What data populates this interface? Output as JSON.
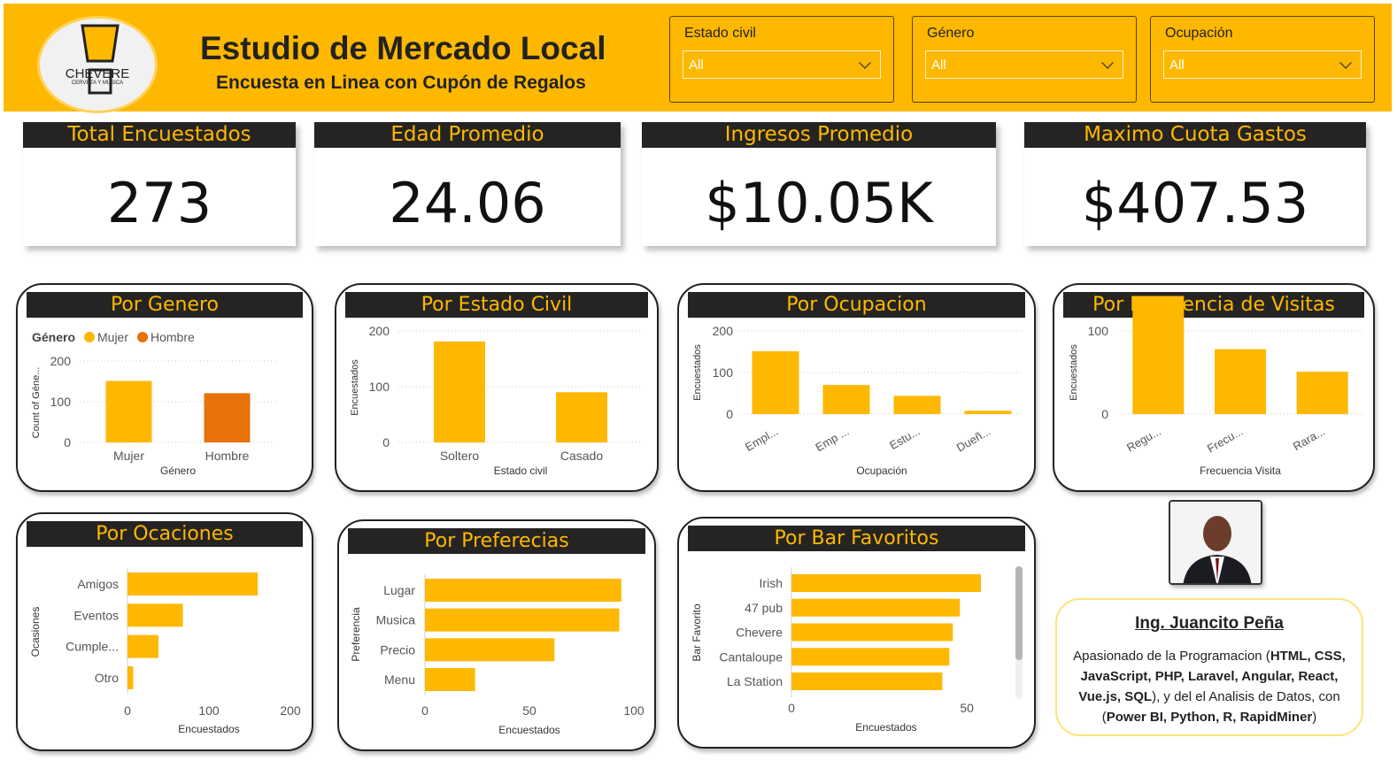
{
  "header": {
    "title": "Estudio de Mercado Local",
    "subtitle": "Encuesta en Linea con Cupón de Regalos",
    "logo_brand": "CHEVERE",
    "logo_tag": "CERVEZA Y MUSICA"
  },
  "slicers": [
    {
      "label": "Estado civil",
      "value": "All"
    },
    {
      "label": "Género",
      "value": "All"
    },
    {
      "label": "Ocupación",
      "value": "All"
    }
  ],
  "kpis": [
    {
      "label": "Total Encuestados",
      "value": "273"
    },
    {
      "label": "Edad Promedio",
      "value": "24.06"
    },
    {
      "label": "Ingresos Promedio",
      "value": "$10.05K"
    },
    {
      "label": "Maximo Cuota Gastos",
      "value": "$407.53"
    }
  ],
  "colors": {
    "accent": "#FFB800",
    "secondary": "#E87208",
    "header_bg": "#252423"
  },
  "chart_data": [
    {
      "id": "genero",
      "type": "bar",
      "title": "Por Genero",
      "legend_title": "Género",
      "legend": [
        "Mujer",
        "Hombre"
      ],
      "categories": [
        "Mujer",
        "Hombre"
      ],
      "values": [
        151,
        121
      ],
      "colors": [
        "#FFB800",
        "#E87208"
      ],
      "xlabel": "Género",
      "ylabel": "Count of Géne...",
      "yticks": [
        0,
        100,
        200
      ],
      "ylim": [
        0,
        200
      ]
    },
    {
      "id": "estado_civil",
      "type": "bar",
      "title": "Por Estado Civil",
      "categories": [
        "Soltero",
        "Casado"
      ],
      "values": [
        181,
        90
      ],
      "xlabel": "Estado civil",
      "ylabel": "Encuestados",
      "yticks": [
        0,
        100,
        200
      ],
      "ylim": [
        0,
        200
      ]
    },
    {
      "id": "ocupacion",
      "type": "bar",
      "title": "Por Ocupacion",
      "categories": [
        "Empl...",
        "Emp ...",
        "Estu...",
        "Dueñ..."
      ],
      "values": [
        151,
        70,
        44,
        8
      ],
      "xlabel": "Ocupación",
      "ylabel": "Encuestados",
      "yticks": [
        0,
        100,
        200
      ],
      "ylim": [
        0,
        200
      ]
    },
    {
      "id": "frecuencia",
      "type": "bar",
      "title": "Por Frecuencia de Visitas",
      "categories": [
        "Regu...",
        "Frecu...",
        "Rara..."
      ],
      "values": [
        142,
        78,
        51
      ],
      "xlabel": "Frecuencia Visita",
      "ylabel": "Encuestados",
      "yticks": [
        0,
        100
      ],
      "ylim": [
        0,
        150
      ]
    },
    {
      "id": "ocasiones",
      "type": "bar",
      "orientation": "horizontal",
      "title": "Por Ocaciones",
      "categories": [
        "Amigos",
        "Eventos",
        "Cumple...",
        "Otro"
      ],
      "values": [
        160,
        68,
        38,
        7
      ],
      "xlabel": "Encuestados",
      "ylabel": "Ocasiones",
      "xticks": [
        0,
        100,
        200
      ],
      "xlim": [
        0,
        200
      ]
    },
    {
      "id": "preferencias",
      "type": "bar",
      "orientation": "horizontal",
      "title": "Por Preferecias",
      "categories": [
        "Lugar",
        "Musica",
        "Precio",
        "Menu"
      ],
      "values": [
        94,
        93,
        62,
        24
      ],
      "xlabel": "Encuestados",
      "ylabel": "Preferencia",
      "xticks": [
        0,
        50,
        100
      ],
      "xlim": [
        0,
        100
      ]
    },
    {
      "id": "bar_favoritos",
      "type": "bar",
      "orientation": "horizontal",
      "title": "Por Bar Favoritos",
      "categories": [
        "Irish",
        "47 pub",
        "Chevere",
        "Cantaloupe",
        "La Station"
      ],
      "values": [
        54,
        48,
        46,
        45,
        43
      ],
      "xlabel": "Encuestados",
      "ylabel": "Bar Favorito",
      "xticks": [
        0,
        50
      ],
      "xlim": [
        0,
        54
      ]
    }
  ],
  "profile": {
    "name": "Ing. Juancito Peña",
    "bio_1": "Apasionado de la Programacion (",
    "bio_2": "HTML, CSS, JavaScript, PHP, Laravel, Angular, React, Vue.js, SQL",
    "bio_3": "), y del el Analisis de Datos, con (",
    "bio_4": "Power BI, Python, R, RapidMiner",
    "bio_5": ")"
  }
}
